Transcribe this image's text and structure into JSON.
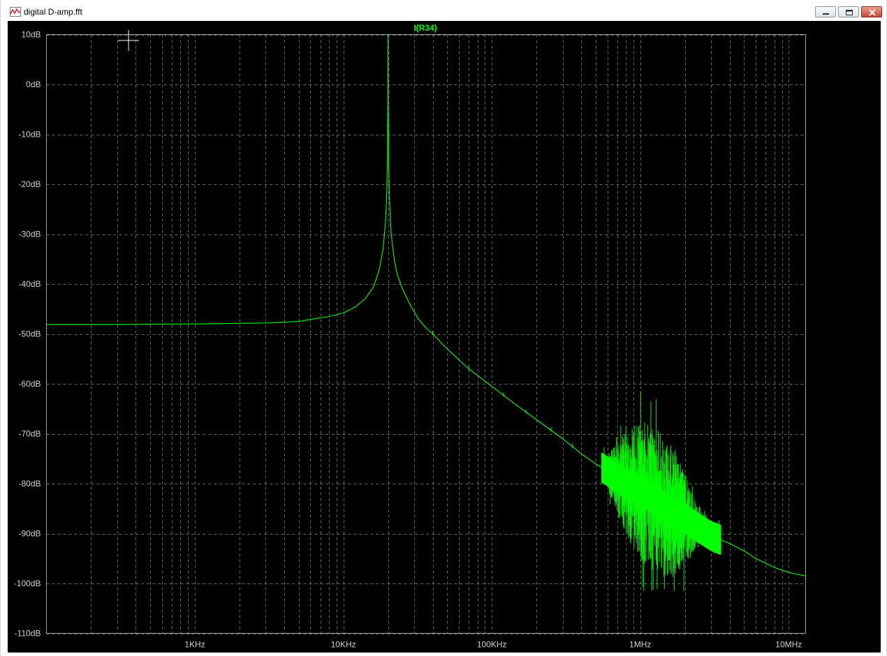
{
  "window": {
    "title": "digital D-amp.fft",
    "app_icon": "waveform-icon",
    "buttons": [
      {
        "name": "minimize-button",
        "icon": "minimize-icon"
      },
      {
        "name": "maximize-button",
        "icon": "maximize-icon"
      },
      {
        "name": "close-button",
        "icon": "close-icon"
      }
    ]
  },
  "colors": {
    "trace": "#00ff00",
    "background": "#000000",
    "grid": "#6a6a6a",
    "axis_text": "#cfcfcf",
    "frame": "#a0a0a0"
  },
  "chart_data": {
    "type": "line",
    "title": "I(R34)",
    "xscale": "log",
    "xlim": [
      100,
      13000000
    ],
    "ylim": [
      -110,
      10
    ],
    "yunit": "dB",
    "x_ticks": [
      1000,
      10000,
      100000,
      1000000,
      10000000
    ],
    "x_tick_labels": [
      "1KHz",
      "10KHz",
      "100KHz",
      "1MHz",
      "10MHz"
    ],
    "y_ticks": [
      10,
      0,
      -10,
      -20,
      -30,
      -40,
      -50,
      -60,
      -70,
      -80,
      -90,
      -100,
      -110
    ],
    "y_tick_labels": [
      "10dB",
      "0dB",
      "-10dB",
      "-20dB",
      "-30dB",
      "-40dB",
      "-50dB",
      "-60dB",
      "-70dB",
      "-80dB",
      "-90dB",
      "-100dB",
      "-110dB"
    ],
    "grid": true,
    "series": [
      {
        "name": "I(R34)",
        "x": [
          100,
          300,
          1000,
          3000,
          5000,
          8000,
          10000,
          12000,
          14000,
          16000,
          17500,
          18500,
          19200,
          19600,
          19800,
          19950,
          20000,
          20050,
          20200,
          20500,
          21000,
          22000,
          23000,
          25000,
          28000,
          32000,
          36000,
          40000,
          50000,
          70000,
          100000,
          150000,
          200000,
          300000,
          400000,
          500000,
          600000,
          700000,
          800000,
          1000000,
          1300000,
          1600000,
          2000000,
          2500000,
          3000000,
          4000000,
          5000000,
          6000000,
          8000000,
          10000000,
          13000000
        ],
        "y": [
          -48.1,
          -48.1,
          -48.0,
          -47.8,
          -47.5,
          -46.5,
          -45.8,
          -44.6,
          -43.0,
          -40.5,
          -37.0,
          -33.0,
          -28.0,
          -22.0,
          -14.0,
          -4.0,
          10.0,
          -4.0,
          -16.0,
          -24.0,
          -30.0,
          -35.0,
          -38.0,
          -41.0,
          -44.0,
          -47.0,
          -48.8,
          -50.0,
          -53.0,
          -57.0,
          -60.5,
          -64.5,
          -67.2,
          -71.0,
          -74.0,
          -76.0,
          -77.5,
          -79.0,
          -80.0,
          -81.5,
          -83.5,
          -85.5,
          -87.0,
          -89.0,
          -90.5,
          -92.0,
          -93.5,
          -95.0,
          -96.8,
          -97.8,
          -98.5
        ]
      }
    ],
    "noise_region": {
      "x_range": [
        550000,
        3500000
      ],
      "peak_db": -58,
      "trough_db": -101.5
    }
  }
}
